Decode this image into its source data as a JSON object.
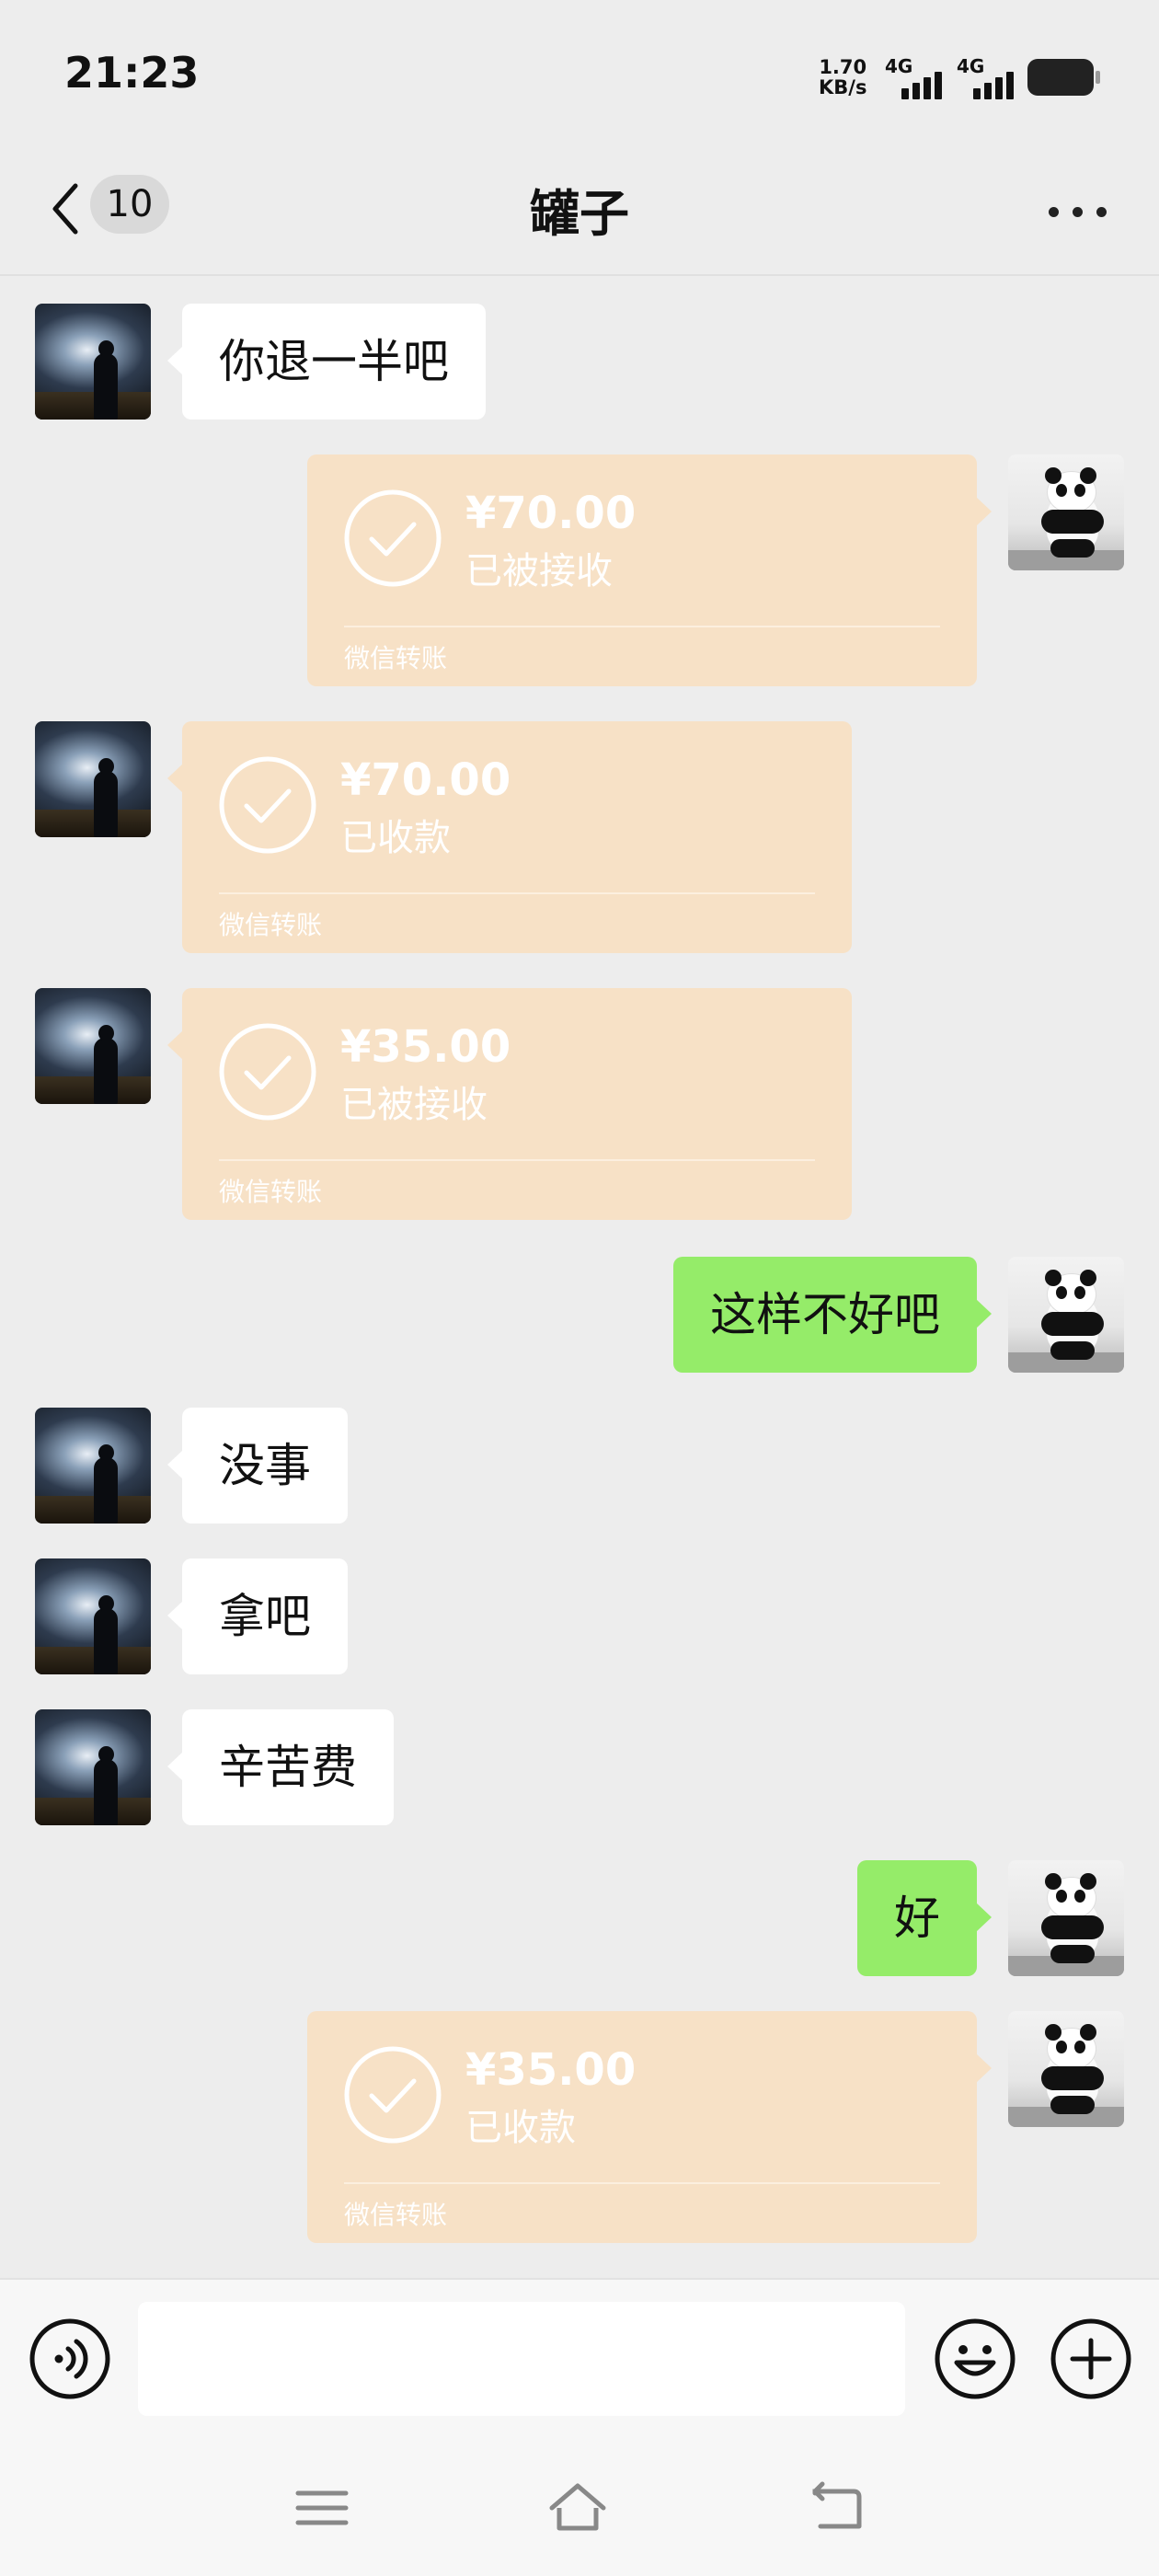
{
  "status_bar": {
    "time": "21:23",
    "net_speed_value": "1.70",
    "net_speed_unit": "KB/s",
    "sim1": "4G",
    "sim2": "4G"
  },
  "header": {
    "unread_count": "10",
    "title": "罐子"
  },
  "messages": [
    {
      "from": "other",
      "kind": "text",
      "text": "你退一半吧"
    },
    {
      "from": "me",
      "kind": "transfer",
      "amount": "¥70.00",
      "status": "已被接收",
      "footer": "微信转账"
    },
    {
      "from": "other",
      "kind": "transfer",
      "amount": "¥70.00",
      "status": "已收款",
      "footer": "微信转账"
    },
    {
      "from": "other",
      "kind": "transfer",
      "amount": "¥35.00",
      "status": "已被接收",
      "footer": "微信转账"
    },
    {
      "from": "me",
      "kind": "text",
      "text": "这样不好吧"
    },
    {
      "from": "other",
      "kind": "text",
      "text": "没事"
    },
    {
      "from": "other",
      "kind": "text",
      "text": "拿吧"
    },
    {
      "from": "other",
      "kind": "text",
      "text": "辛苦费"
    },
    {
      "from": "me",
      "kind": "text",
      "text": "好"
    },
    {
      "from": "me",
      "kind": "transfer",
      "amount": "¥35.00",
      "status": "已收款",
      "footer": "微信转账"
    }
  ],
  "input_bar": {
    "voice_icon": "voice-icon",
    "emoji_icon": "emoji-icon",
    "plus_icon": "plus-icon",
    "input_value": ""
  },
  "nav_bar": {
    "icons": [
      "menu-icon",
      "home-icon",
      "back-icon"
    ]
  },
  "colors": {
    "background": "#ededed",
    "outgoing_bubble": "#95ec69",
    "incoming_bubble": "#ffffff",
    "transfer_card": "#f7e1c6"
  }
}
